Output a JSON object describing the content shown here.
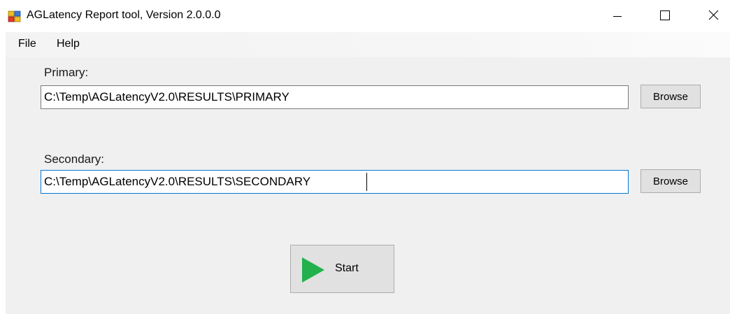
{
  "window": {
    "title": "AGLatency Report tool, Version 2.0.0.0",
    "app_icon": "app-windows-icon",
    "controls": {
      "minimize_icon": "minimize-icon",
      "maximize_icon": "maximize-icon",
      "close_icon": "close-icon"
    }
  },
  "menubar": {
    "items": [
      {
        "label": "File"
      },
      {
        "label": "Help"
      }
    ]
  },
  "form": {
    "primary": {
      "label": "Primary:",
      "value": "C:\\Temp\\AGLatencyV2.0\\RESULTS\\PRIMARY",
      "browse_label": "Browse"
    },
    "secondary": {
      "label": "Secondary:",
      "value": "C:\\Temp\\AGLatencyV2.0\\RESULTS\\SECONDARY",
      "browse_label": "Browse",
      "focused": true
    },
    "start": {
      "label": "Start",
      "icon": "play-icon",
      "icon_color": "#22b14c"
    }
  },
  "colors": {
    "client_background": "#f0f0f0",
    "button_face": "#e1e1e1",
    "focus_border": "#0078d7"
  }
}
